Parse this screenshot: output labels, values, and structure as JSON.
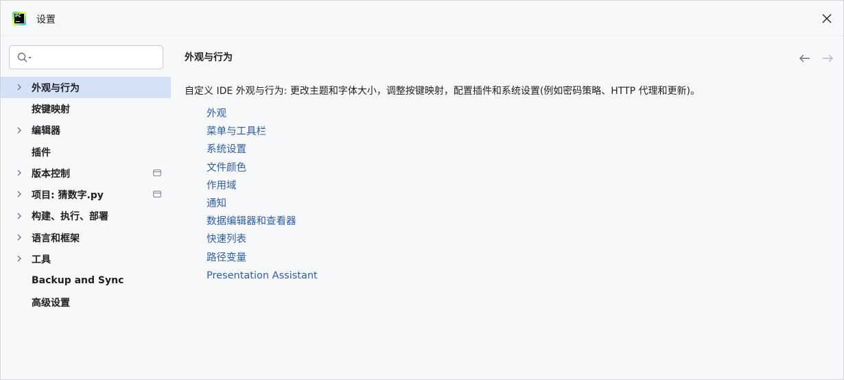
{
  "window": {
    "title": "设置",
    "logo_text": "PC"
  },
  "search": {
    "placeholder": "",
    "value": ""
  },
  "sidebar": {
    "items": [
      {
        "label": "外观与行为",
        "expandable": true,
        "selected": true,
        "badge": false
      },
      {
        "label": "按键映射",
        "expandable": false,
        "selected": false,
        "badge": false
      },
      {
        "label": "编辑器",
        "expandable": true,
        "selected": false,
        "badge": false
      },
      {
        "label": "插件",
        "expandable": false,
        "selected": false,
        "badge": false
      },
      {
        "label": "版本控制",
        "expandable": true,
        "selected": false,
        "badge": true
      },
      {
        "label": "项目: 猜数字.py",
        "expandable": true,
        "selected": false,
        "badge": true
      },
      {
        "label": "构建、执行、部署",
        "expandable": true,
        "selected": false,
        "badge": false
      },
      {
        "label": "语言和框架",
        "expandable": true,
        "selected": false,
        "badge": false
      },
      {
        "label": "工具",
        "expandable": true,
        "selected": false,
        "badge": false
      },
      {
        "label": "Backup and Sync",
        "expandable": false,
        "selected": false,
        "badge": false
      },
      {
        "label": "高级设置",
        "expandable": false,
        "selected": false,
        "badge": false
      }
    ]
  },
  "main": {
    "title": "外观与行为",
    "description": "自定义 IDE 外观与行为: 更改主题和字体大小，调整按键映射，配置插件和系统设置(例如密码策略、HTTP 代理和更新)。",
    "links": [
      "外观",
      "菜单与工具栏",
      "系统设置",
      "文件颜色",
      "作用域",
      "通知",
      "数据编辑器和查看器",
      "快速列表",
      "路径变量",
      "Presentation Assistant"
    ]
  },
  "colors": {
    "background": "#f7f8fa",
    "selection": "#d5e1f7",
    "link": "#2e5ca8"
  },
  "icons": {
    "close": "close-icon",
    "search": "search-icon",
    "back": "arrow-left-icon",
    "forward": "arrow-right-icon",
    "expand": "chevron-right-icon",
    "badge": "project-level-icon"
  }
}
